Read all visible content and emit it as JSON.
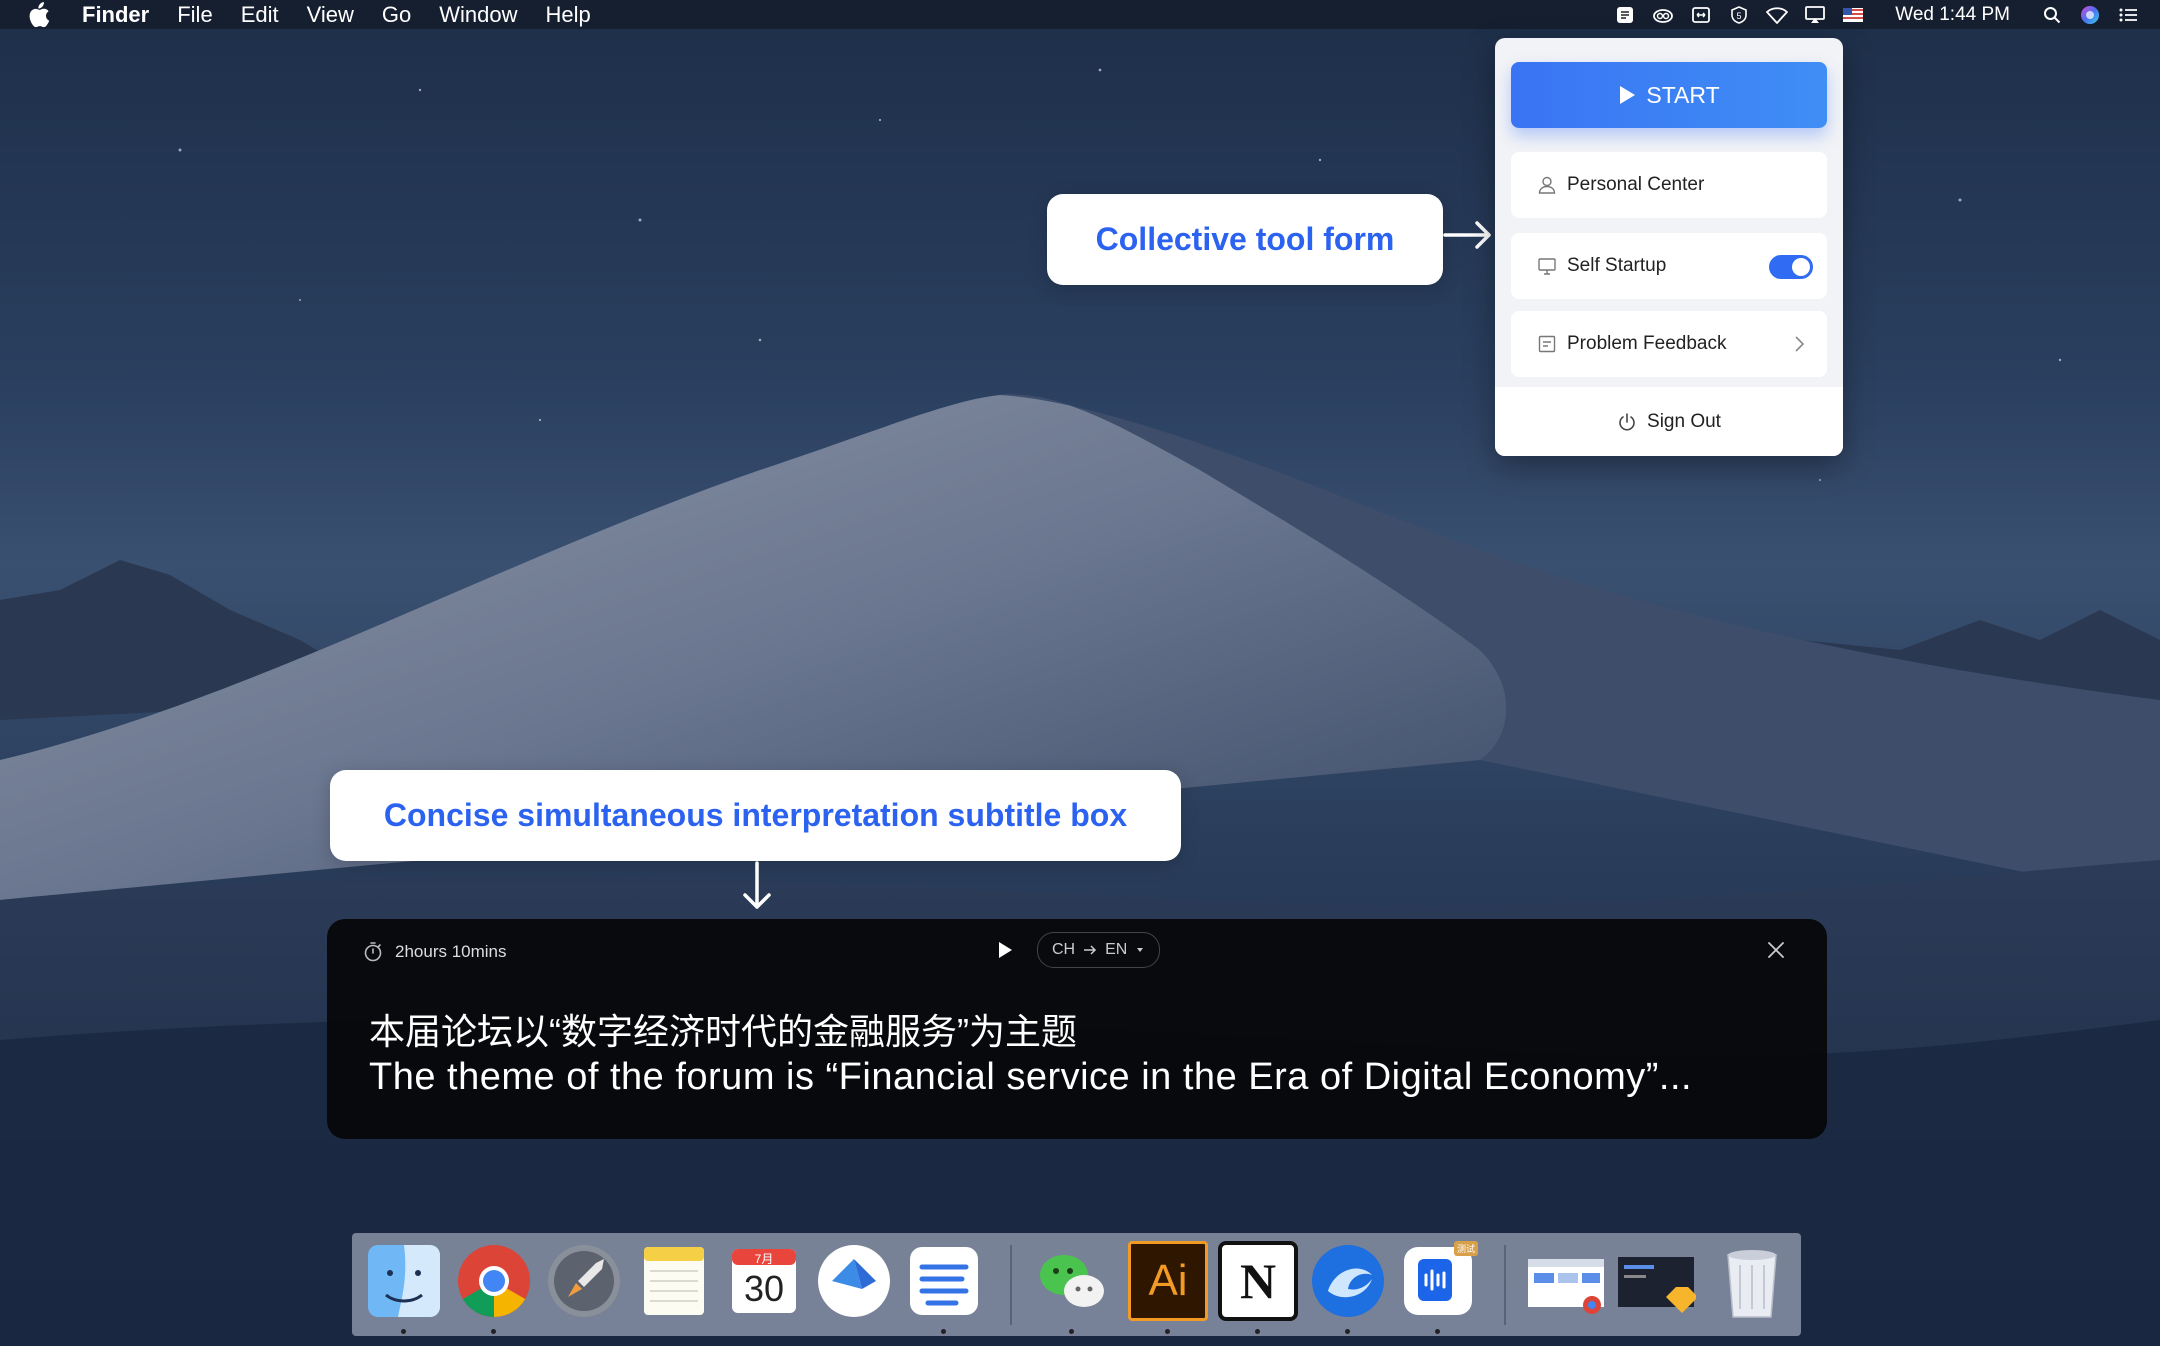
{
  "menubar": {
    "items": [
      "Finder",
      "File",
      "Edit",
      "View",
      "Go",
      "Window",
      "Help"
    ],
    "clock": "Wed 1:44 PM",
    "status_icons": [
      "note-icon",
      "creative-cloud-icon",
      "resize-icon",
      "shield-5-icon",
      "wifi-icon",
      "airplay-icon",
      "us-flag-icon",
      "search-icon",
      "siri-icon",
      "control-list-icon"
    ]
  },
  "callouts": {
    "tool_form": "Collective tool form",
    "subtitle_box": "Concise simultaneous interpretation subtitle box"
  },
  "panel": {
    "start": "START",
    "personal_center": "Personal Center",
    "self_startup": "Self Startup",
    "self_startup_on": true,
    "problem_feedback": "Problem Feedback",
    "sign_out": "Sign Out"
  },
  "subtitle": {
    "duration": "2hours 10mins",
    "lang_from": "CH",
    "lang_to": "EN",
    "line1": "本届论坛以“数字经济时代的金融服务”为主题",
    "line2": "The theme of the forum is “Financial service in the Era of Digital Economy”..."
  },
  "dock": {
    "apps": [
      "finder-icon",
      "chrome-icon",
      "launchpad-icon",
      "notes-icon",
      "calendar-icon",
      "lark-icon",
      "stacks-icon",
      "wechat-icon",
      "illustrator-icon",
      "notion-icon",
      "browser-icon",
      "app-icon",
      "screenshot-thumb-icon",
      "sketch-thumb-icon",
      "trash-icon"
    ],
    "calendar_month": "7月",
    "calendar_day": "30",
    "illustrator_label": "Ai",
    "notion_label": "N",
    "badge_label": "测试"
  },
  "colors": {
    "accent": "#2b62f0",
    "toggle_on": "#2f6cf3"
  }
}
